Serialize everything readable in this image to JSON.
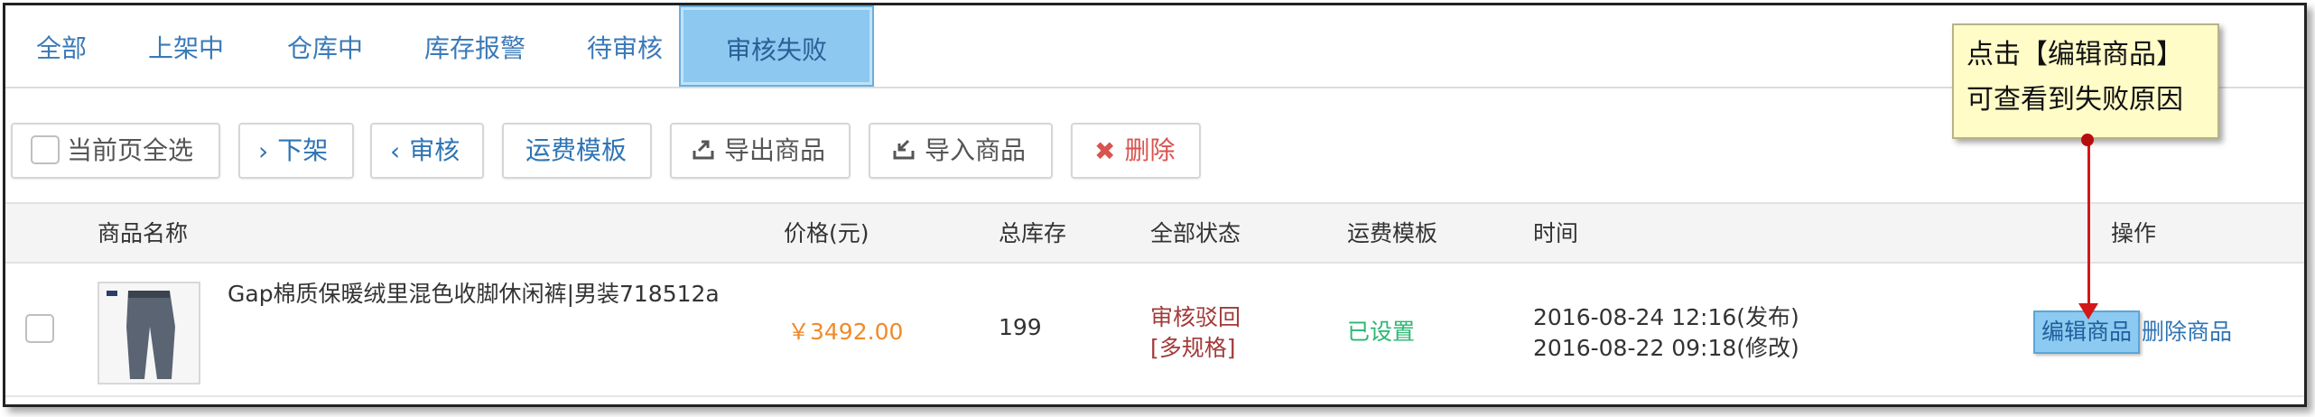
{
  "tabs": [
    "全部",
    "上架中",
    "仓库中",
    "库存报警",
    "待审核",
    "审核失败"
  ],
  "toolbar": {
    "select_all": "当前页全选",
    "off_shelf": "下架",
    "review": "审核",
    "shipping_template": "运费模板",
    "export": "导出商品",
    "import": "导入商品",
    "delete": "删除"
  },
  "table": {
    "headers": {
      "name": "商品名称",
      "price": "价格(元)",
      "stock": "总库存",
      "status": "全部状态",
      "shipping": "运费模板",
      "time": "时间",
      "actions": "操作"
    },
    "rows": [
      {
        "name": "Gap棉质保暖绒里混色收脚休闲裤|男装718512a",
        "price": "￥3492.00",
        "stock": "199",
        "status_line1": "审核驳回",
        "status_line2": "[多规格]",
        "shipping": "已设置",
        "time_published": "2016-08-24 12:16(发布)",
        "time_modified": "2016-08-22 09:18(修改)",
        "edit": "编辑商品",
        "delete": "删除商品"
      }
    ]
  },
  "callout": {
    "line1": "点击【编辑商品】",
    "line2": "可查看到失败原因"
  },
  "colors": {
    "link": "#2f74b5",
    "price": "#f08a2a",
    "status_rejected": "#a33a3a",
    "shipping_set": "#2bb673",
    "delete_red": "#d9534f",
    "highlight": "#8cc8f0",
    "callout_bg": "#fffcc8"
  }
}
